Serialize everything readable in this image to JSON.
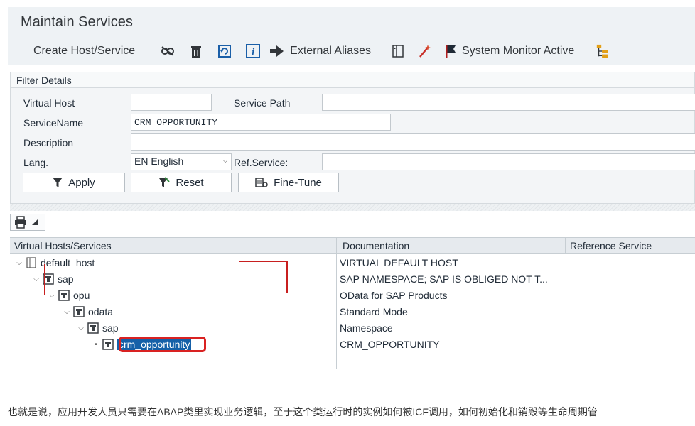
{
  "window": {
    "title": "Maintain Services"
  },
  "toolbar": {
    "create_label": "Create Host/Service",
    "external_aliases_label": "External Aliases",
    "system_monitor_label": "System Monitor Active",
    "icons": [
      "glasses-icon",
      "trash-icon",
      "refresh-icon",
      "info-icon",
      "arrow-right-icon",
      "tree-icon",
      "magic-wand-icon",
      "flag-icon",
      "hierarchy-icon"
    ]
  },
  "filter": {
    "title": "Filter Details",
    "virtual_host_label": "Virtual Host",
    "virtual_host_value": "",
    "service_path_label": "Service Path",
    "service_path_value": "",
    "service_name_label": "ServiceName",
    "service_name_value": "CRM_OPPORTUNITY",
    "description_label": "Description",
    "description_value": "",
    "lang_label": "Lang.",
    "lang_value": "EN English",
    "ref_service_label": "Ref.Service:",
    "ref_service_value": "",
    "apply_label": "Apply",
    "reset_label": "Reset",
    "finetune_label": "Fine-Tune"
  },
  "tree": {
    "columns": [
      "Virtual Hosts/Services",
      "Documentation",
      "Reference Service"
    ],
    "rows": [
      {
        "name": "default_host",
        "doc": "VIRTUAL DEFAULT HOST"
      },
      {
        "name": "sap",
        "doc": "SAP NAMESPACE; SAP IS OBLIGED NOT T..."
      },
      {
        "name": "opu",
        "doc": "OData for SAP Products"
      },
      {
        "name": "odata",
        "doc": "Standard Mode"
      },
      {
        "name": "sap",
        "doc": "Namespace"
      },
      {
        "name": "crm_opportunity",
        "doc": "CRM_OPPORTUNITY"
      }
    ]
  },
  "caption": "也就是说，应用开发人员只需要在ABAP类里实现业务逻辑，至于这个类运行时的实例如何被ICF调用，如何初始化和销毁等生命周期管",
  "colors": {
    "highlight": "#d92222",
    "selection": "#1560a8",
    "panel": "#eef2f5"
  }
}
